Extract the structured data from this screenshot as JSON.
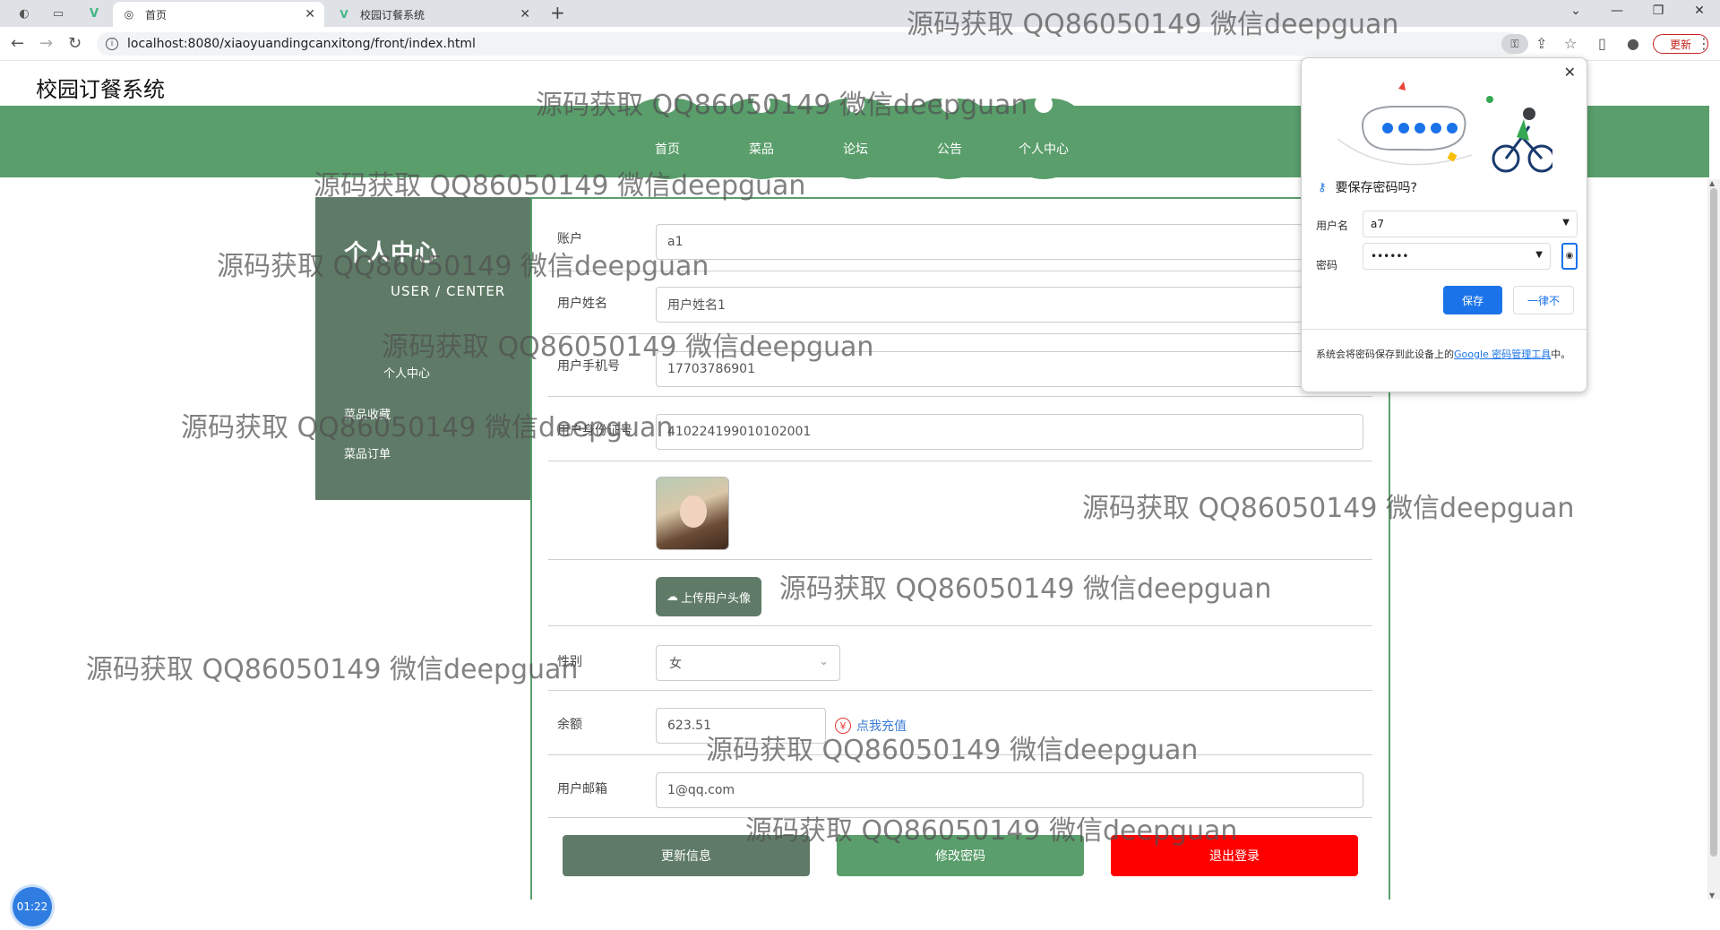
{
  "browser": {
    "tabs": [
      {
        "title": "首页",
        "active": true
      },
      {
        "title": "校园订餐系统",
        "active": false
      }
    ],
    "url": "localhost:8080/xiaoyuandingcanxitong/front/index.html",
    "update_label": "更新"
  },
  "site": {
    "title": "校园订餐系统",
    "nav": [
      "首页",
      "菜品",
      "论坛",
      "公告",
      "个人中心"
    ]
  },
  "sidebar": {
    "title": "个人中心",
    "subtitle": "USER / CENTER",
    "items": [
      "个人中心",
      "菜品收藏",
      "菜品订单"
    ]
  },
  "form": {
    "account": {
      "label": "账户",
      "value": "a1"
    },
    "name": {
      "label": "用户姓名",
      "value": "用户姓名1"
    },
    "phone": {
      "label": "用户手机号",
      "value": "17703786901"
    },
    "id_card": {
      "label": "用户身份证号",
      "value": "410224199010102001"
    },
    "upload_label": "上传用户头像",
    "gender": {
      "label": "性别",
      "value": "女"
    },
    "balance": {
      "label": "余额",
      "value": "623.51",
      "recharge": "点我充值"
    },
    "email": {
      "label": "用户邮箱",
      "value": "1@qq.com"
    },
    "buttons": {
      "update": "更新信息",
      "change_password": "修改密码",
      "logout": "退出登录"
    }
  },
  "password_popup": {
    "title": "要保存密码吗?",
    "username_label": "用户名",
    "username": "a7",
    "password_label": "密码",
    "password_mask": "••••••",
    "save": "保存",
    "never": "一律不",
    "note_prefix": "系统会将密码保存到此设备上的",
    "note_link": "Google 密码管理工具",
    "note_suffix": "中。"
  },
  "timer": "01:22",
  "watermark": "源码获取 QQ86050149 微信deepguan",
  "colors": {
    "brand_green": "#5a9e6b",
    "sidebar": "#5f7b67",
    "logout_red": "#ff0000",
    "chrome_blue": "#1a73e8"
  }
}
